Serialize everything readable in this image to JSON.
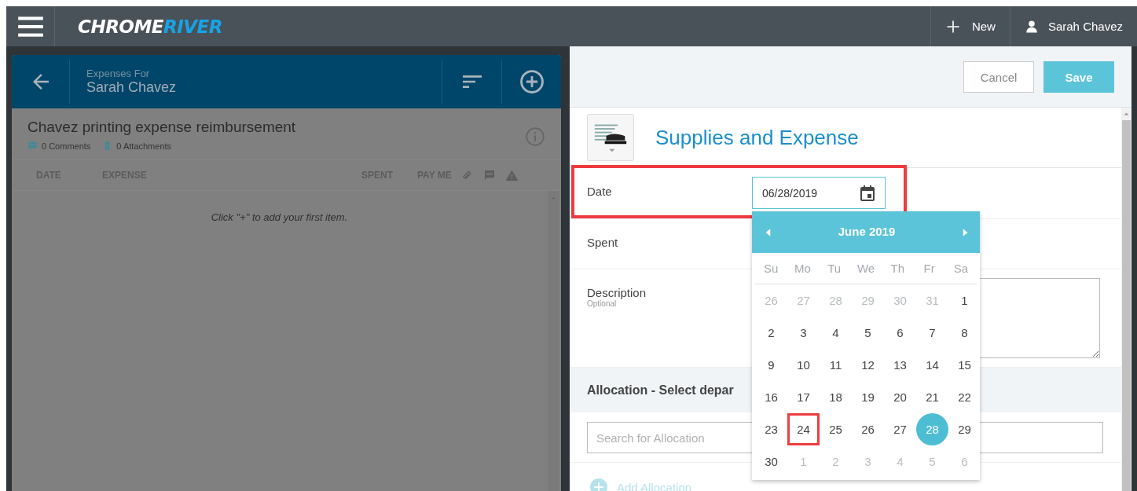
{
  "top_bar": {
    "logo": {
      "first": "CHROME",
      "second": "RIVER"
    },
    "new_button": "New",
    "user": "Sarah Chavez"
  },
  "report": {
    "header_caption": "Expenses For",
    "owner": "Sarah Chavez",
    "title": "Chavez printing expense reimbursement",
    "comments": "0 Comments",
    "attachments": "0 Attachments",
    "columns": [
      "DATE",
      "EXPENSE",
      "SPENT",
      "PAY ME"
    ],
    "empty_message": "Click \"+\" to add your first item."
  },
  "form": {
    "buttons": [
      {
        "label": "Cancel",
        "kind": "secondary"
      },
      {
        "label": "Save",
        "kind": "primary"
      }
    ],
    "category": "Supplies and Expense",
    "fields": [
      {
        "label": "Date",
        "kind": "date",
        "value": "06/28/2019",
        "highlighted": true
      },
      {
        "label": "Spent",
        "kind": "amount"
      },
      {
        "label": "Description",
        "hint": "Optional",
        "kind": "textarea"
      }
    ],
    "allocation": {
      "heading": "Allocation - Select depar",
      "placeholder": "Search for Allocation",
      "add_link": "Add Allocation"
    }
  },
  "date_picker": {
    "month": "June 2019",
    "weekdays": [
      "Su",
      "Mo",
      "Tu",
      "We",
      "Th",
      "Fr",
      "Sa"
    ],
    "weeks": [
      [
        {
          "day": "26",
          "outside": true,
          "selected": false,
          "highlighted": false
        },
        {
          "day": "27",
          "outside": true,
          "selected": false,
          "highlighted": false
        },
        {
          "day": "28",
          "outside": true,
          "selected": false,
          "highlighted": false
        },
        {
          "day": "29",
          "outside": true,
          "selected": false,
          "highlighted": false
        },
        {
          "day": "30",
          "outside": true,
          "selected": false,
          "highlighted": false
        },
        {
          "day": "31",
          "outside": true,
          "selected": false,
          "highlighted": false
        },
        {
          "day": "1",
          "outside": false,
          "selected": false,
          "highlighted": false
        }
      ],
      [
        {
          "day": "2",
          "outside": false,
          "selected": false,
          "highlighted": false
        },
        {
          "day": "3",
          "outside": false,
          "selected": false,
          "highlighted": false
        },
        {
          "day": "4",
          "outside": false,
          "selected": false,
          "highlighted": false
        },
        {
          "day": "5",
          "outside": false,
          "selected": false,
          "highlighted": false
        },
        {
          "day": "6",
          "outside": false,
          "selected": false,
          "highlighted": false
        },
        {
          "day": "7",
          "outside": false,
          "selected": false,
          "highlighted": false
        },
        {
          "day": "8",
          "outside": false,
          "selected": false,
          "highlighted": false
        }
      ],
      [
        {
          "day": "9",
          "outside": false,
          "selected": false,
          "highlighted": false
        },
        {
          "day": "10",
          "outside": false,
          "selected": false,
          "highlighted": false
        },
        {
          "day": "11",
          "outside": false,
          "selected": false,
          "highlighted": false
        },
        {
          "day": "12",
          "outside": false,
          "selected": false,
          "highlighted": false
        },
        {
          "day": "13",
          "outside": false,
          "selected": false,
          "highlighted": false
        },
        {
          "day": "14",
          "outside": false,
          "selected": false,
          "highlighted": false
        },
        {
          "day": "15",
          "outside": false,
          "selected": false,
          "highlighted": false
        }
      ],
      [
        {
          "day": "16",
          "outside": false,
          "selected": false,
          "highlighted": false
        },
        {
          "day": "17",
          "outside": false,
          "selected": false,
          "highlighted": false
        },
        {
          "day": "18",
          "outside": false,
          "selected": false,
          "highlighted": false
        },
        {
          "day": "19",
          "outside": false,
          "selected": false,
          "highlighted": false
        },
        {
          "day": "20",
          "outside": false,
          "selected": false,
          "highlighted": false
        },
        {
          "day": "21",
          "outside": false,
          "selected": false,
          "highlighted": false
        },
        {
          "day": "22",
          "outside": false,
          "selected": false,
          "highlighted": false
        }
      ],
      [
        {
          "day": "23",
          "outside": false,
          "selected": false,
          "highlighted": false
        },
        {
          "day": "24",
          "outside": false,
          "selected": false,
          "highlighted": true
        },
        {
          "day": "25",
          "outside": false,
          "selected": false,
          "highlighted": false
        },
        {
          "day": "26",
          "outside": false,
          "selected": false,
          "highlighted": false
        },
        {
          "day": "27",
          "outside": false,
          "selected": false,
          "highlighted": false
        },
        {
          "day": "28",
          "outside": false,
          "selected": true,
          "highlighted": false
        },
        {
          "day": "29",
          "outside": false,
          "selected": false,
          "highlighted": false
        }
      ],
      [
        {
          "day": "30",
          "outside": false,
          "selected": false,
          "highlighted": false
        },
        {
          "day": "1",
          "outside": true,
          "selected": false,
          "highlighted": false
        },
        {
          "day": "2",
          "outside": true,
          "selected": false,
          "highlighted": false
        },
        {
          "day": "3",
          "outside": true,
          "selected": false,
          "highlighted": false
        },
        {
          "day": "4",
          "outside": true,
          "selected": false,
          "highlighted": false
        },
        {
          "day": "5",
          "outside": true,
          "selected": false,
          "highlighted": false
        },
        {
          "day": "6",
          "outside": true,
          "selected": false,
          "highlighted": false
        }
      ]
    ]
  }
}
